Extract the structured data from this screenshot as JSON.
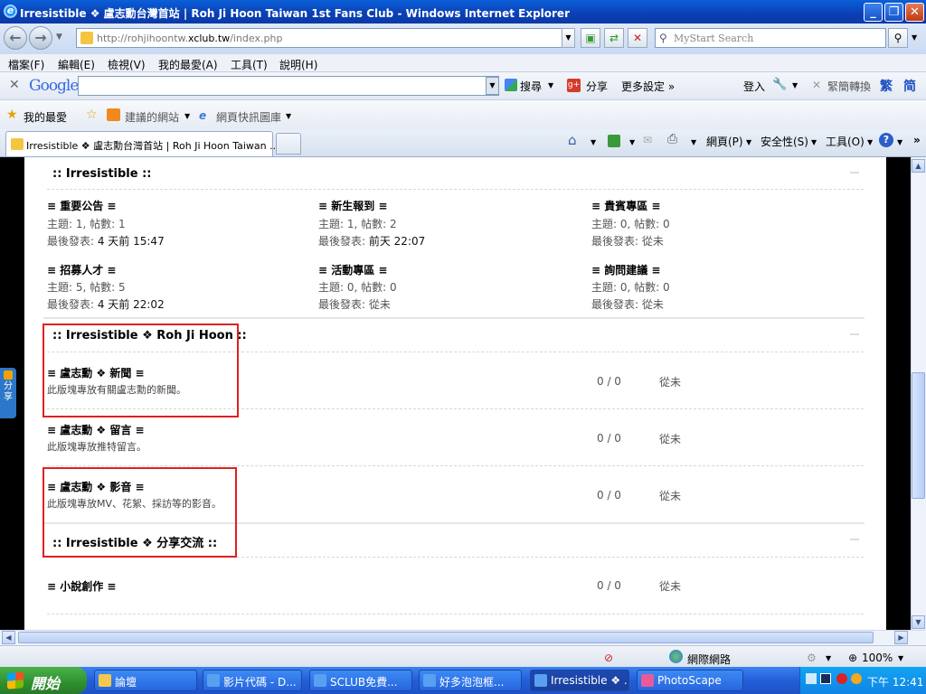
{
  "window": {
    "title": "Irresistible ❖ 盧志勳台灣首站 | Roh Ji Hoon Taiwan 1st Fans Club - Windows Internet Explorer",
    "min_glyph": "_",
    "max_glyph": "❐",
    "close_glyph": "✕"
  },
  "address": {
    "url_prefix": "http://rohjihoontw.",
    "url_domain": "xclub.tw",
    "url_suffix": "/index.php",
    "search_placeholder": "MyStart Search"
  },
  "menu": [
    "檔案(F)",
    "編輯(E)",
    "檢視(V)",
    "我的最愛(A)",
    "工具(T)",
    "說明(H)"
  ],
  "google_toolbar": {
    "logo": "Google",
    "search_label": "搜尋",
    "share_label": "分享",
    "more_settings": "更多設定 »",
    "signin": "登入",
    "convert": "緊簡轉換",
    "trad": "繁",
    "simp": "简"
  },
  "favorites_bar": {
    "favorites": "我的最愛",
    "suggested": "建議的網站",
    "web_slice": "網頁快訊圖庫"
  },
  "tabs": {
    "active_title": "Irresistible ❖ 盧志勳台灣首站 | Roh Ji Hoon Taiwan ...",
    "command_page": "網頁(P)",
    "command_safety": "安全性(S)",
    "command_tools": "工具(O)",
    "more": "»"
  },
  "content": {
    "section1": {
      "title": ":: Irresistible ::",
      "forums": [
        {
          "name": "≡ 重要公告 ≡",
          "topics": "主題: 1, 帖數: 1",
          "last_label": "最後發表: ",
          "last": "4 天前 15:47"
        },
        {
          "name": "≡ 新生報到 ≡",
          "topics": "主題: 1, 帖數: 2",
          "last_label": "最後發表: ",
          "last": "前天 22:07"
        },
        {
          "name": "≡ 貴賓專區 ≡",
          "topics": "主題: 0, 帖數: 0",
          "last_label": "最後發表: ",
          "last": "從未"
        },
        {
          "name": "≡ 招募人才 ≡",
          "topics": "主題: 5, 帖數: 5",
          "last_label": "最後發表: ",
          "last": "4 天前 22:02"
        },
        {
          "name": "≡ 活動專區 ≡",
          "topics": "主題: 0, 帖數: 0",
          "last_label": "最後發表: ",
          "last": "從未"
        },
        {
          "name": "≡ 詢問建議 ≡",
          "topics": "主題: 0, 帖數: 0",
          "last_label": "最後發表: ",
          "last": "從未"
        }
      ]
    },
    "section2": {
      "title": ":: Irresistible ❖ Roh Ji Hoon ::",
      "forums": [
        {
          "name": "≡ 盧志勳 ❖ 新聞 ≡",
          "desc": "此版塊專放有關盧志勳的新聞。",
          "count": "0 / 0",
          "last": "從未"
        },
        {
          "name": "≡ 盧志勳 ❖ 留言 ≡",
          "desc": "此版塊專放推特留言。",
          "count": "0 / 0",
          "last": "從未"
        },
        {
          "name": "≡ 盧志勳 ❖ 影音 ≡",
          "desc": "此版塊專放MV、花絮、採訪等的影音。",
          "count": "0 / 0",
          "last": "從未"
        }
      ]
    },
    "section3": {
      "title": ":: Irresistible ❖ 分享交流 ::",
      "forums": [
        {
          "name": "≡ 小說創作 ≡",
          "count": "0 / 0",
          "last": "從未"
        }
      ]
    },
    "share_tab": "分享"
  },
  "statusbar": {
    "zone": "網際網路",
    "zoom": "100%"
  },
  "taskbar": {
    "start": "開始",
    "items": [
      "論壇",
      "影片代碼 - D...",
      "SCLUB免費...",
      "好多泡泡框...",
      "Irresistible ❖ ...",
      "PhotoScape"
    ],
    "clock": "下午 12:41"
  }
}
